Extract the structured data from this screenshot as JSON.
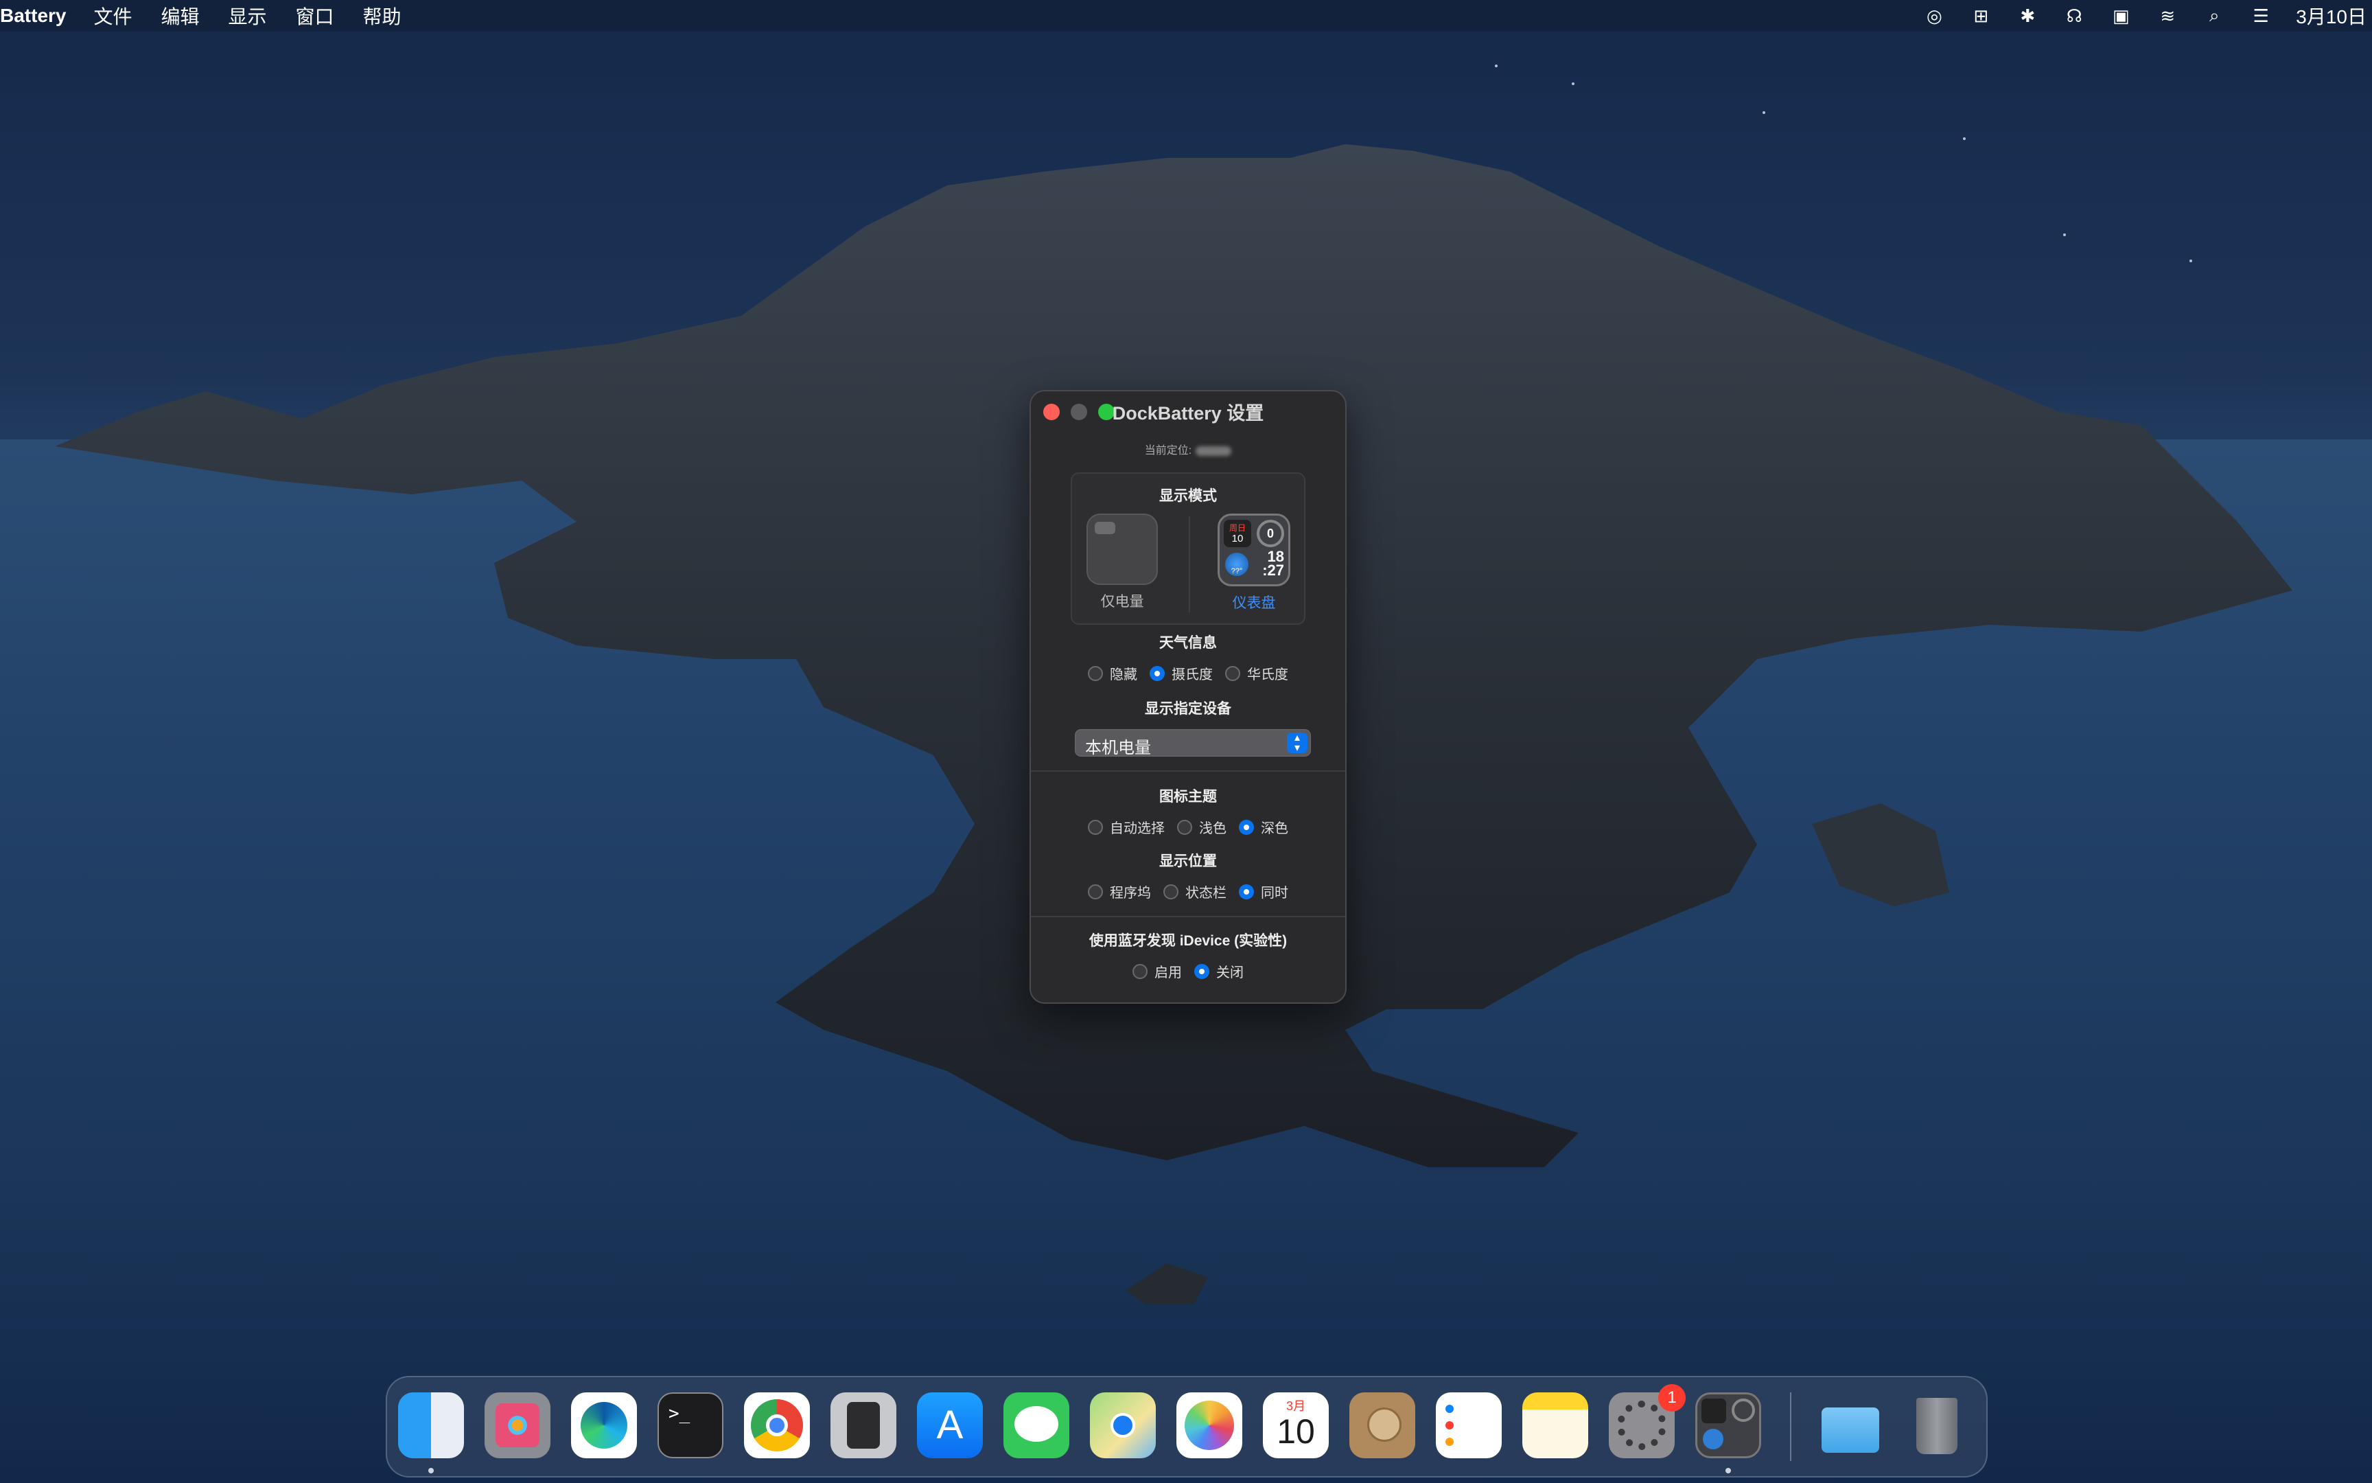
{
  "menubar": {
    "app_name": "Battery",
    "items": [
      "文件",
      "编辑",
      "显示",
      "窗口",
      "帮助"
    ],
    "clock": "3月10日"
  },
  "window": {
    "title": "DockBattery 设置",
    "location_label": "当前定位:",
    "display_mode": {
      "heading": "显示模式",
      "options": [
        {
          "label": "仅电量",
          "selected": false
        },
        {
          "label": "仪表盘",
          "selected": true
        }
      ],
      "widget": {
        "day": "周日",
        "date": "10",
        "ring": "0",
        "temp": "??°",
        "hour": "18",
        "minute": ":27"
      }
    },
    "weather": {
      "heading": "天气信息",
      "options": [
        {
          "label": "隐藏",
          "selected": false
        },
        {
          "label": "摄氏度",
          "selected": true
        },
        {
          "label": "华氏度",
          "selected": false
        }
      ]
    },
    "device": {
      "heading": "显示指定设备",
      "selected_value": "本机电量"
    },
    "theme": {
      "heading": "图标主题",
      "options": [
        {
          "label": "自动选择",
          "selected": false
        },
        {
          "label": "浅色",
          "selected": false
        },
        {
          "label": "深色",
          "selected": true
        }
      ]
    },
    "position": {
      "heading": "显示位置",
      "options": [
        {
          "label": "程序坞",
          "selected": false
        },
        {
          "label": "状态栏",
          "selected": false
        },
        {
          "label": "同时",
          "selected": true
        }
      ]
    },
    "bluetooth": {
      "heading": "使用蓝牙发现 iDevice (实验性)",
      "options": [
        {
          "label": "启用",
          "selected": false
        },
        {
          "label": "关闭",
          "selected": true
        }
      ]
    }
  },
  "dock": {
    "calendar": {
      "month": "3月",
      "day": "10"
    },
    "settings_badge": "1",
    "accent_color": "#0a74ee"
  }
}
